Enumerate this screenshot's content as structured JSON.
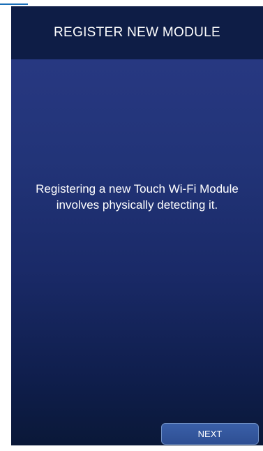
{
  "header": {
    "title": "REGISTER NEW MODULE"
  },
  "main": {
    "message": "Registering a new Touch Wi-Fi Module involves physically detecting it."
  },
  "footer": {
    "next_label": "NEXT"
  },
  "colors": {
    "header_background": "#0e1d46",
    "screen_gradient_top": "#2a3a86",
    "screen_gradient_bottom": "#0a1838",
    "button_background": "#2e4f93",
    "button_border": "#6f8fc4",
    "text": "#ffffff"
  }
}
